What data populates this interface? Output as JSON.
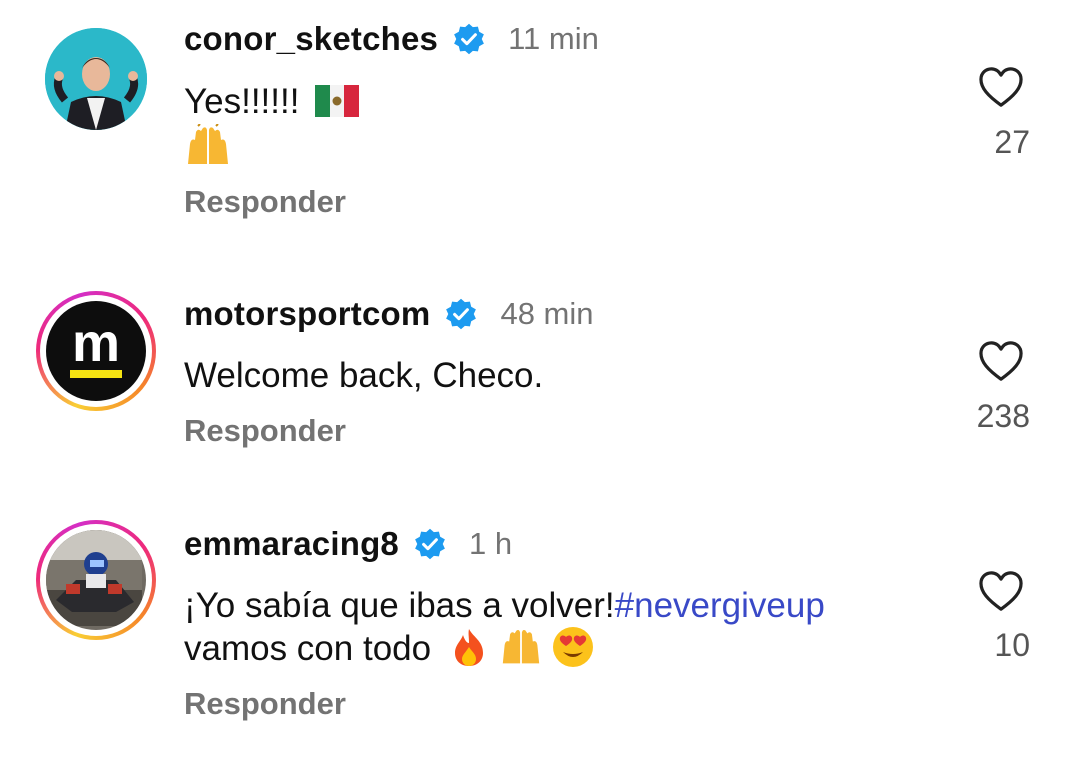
{
  "comments": [
    {
      "username": "conor_sketches",
      "time": "11 min",
      "text_line1": "Yes!!!!!!",
      "text_line2": "",
      "likes": "27",
      "reply_label": "Responder",
      "verified": true,
      "story_ring": false
    },
    {
      "username": "motorsportcom",
      "time": "48 min",
      "text_line1": "Welcome back, Checo.",
      "likes": "238",
      "reply_label": "Responder",
      "verified": true,
      "story_ring": true,
      "avatar_glyph": "m"
    },
    {
      "username": "emmaracing8",
      "time": "1 h",
      "text_line1": "¡Yo sabía que ibas a volver!",
      "hashtag": "#nevergiveup",
      "text_line2": "vamos con todo",
      "likes": "10",
      "reply_label": "Responder",
      "verified": true,
      "story_ring": true
    }
  ],
  "icons": {
    "like": "heart-outline-icon",
    "verified": "verified-badge-icon",
    "flag": "mexico-flag-icon",
    "raised_hands": "raising-hands-icon",
    "fire": "fire-icon",
    "heart_eyes": "heart-eyes-icon"
  },
  "colors": {
    "verified": "#1d9bf0",
    "hashtag": "#3949c7",
    "muted": "#737373"
  }
}
